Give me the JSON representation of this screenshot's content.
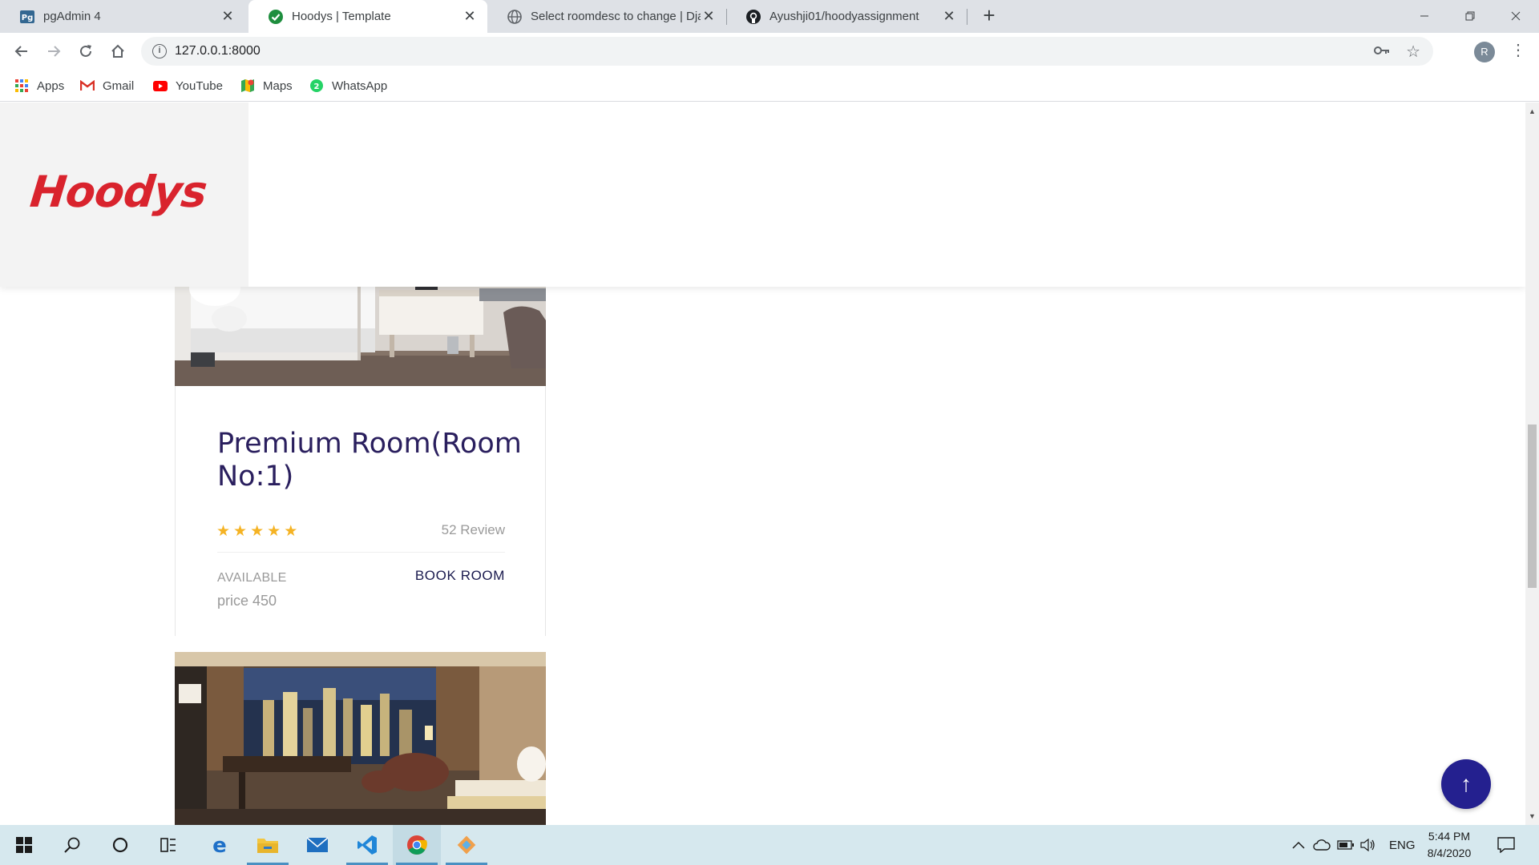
{
  "browser": {
    "tabs": [
      {
        "label": "pgAdmin 4",
        "icon": "pgadmin-icon",
        "active": false
      },
      {
        "label": "Hoodys | Template",
        "icon": "check-circle-icon",
        "active": true
      },
      {
        "label": "Select roomdesc to change | Djan",
        "icon": "globe-icon",
        "active": false
      },
      {
        "label": "Ayushji01/hoodyassignment",
        "icon": "github-icon",
        "active": false
      }
    ],
    "new_tab_glyph": "+",
    "url": "127.0.0.1:8000",
    "profile_initial": "R",
    "bookmarks": [
      {
        "label": "Apps",
        "icon": "apps-grid-icon"
      },
      {
        "label": "Gmail",
        "icon": "gmail-icon"
      },
      {
        "label": "YouTube",
        "icon": "youtube-icon"
      },
      {
        "label": "Maps",
        "icon": "maps-icon"
      },
      {
        "label": "WhatsApp",
        "icon": "whatsapp-icon"
      }
    ]
  },
  "page": {
    "logo": "Hoodys",
    "rooms": [
      {
        "title": "Premium Room(Room No:1)",
        "rating": 5,
        "reviews": "52 Review",
        "status": "AVAILABLE",
        "price": "price 450",
        "book_label": "BOOK ROOM"
      }
    ],
    "scroll_top_glyph": "↑"
  },
  "taskbar": {
    "apps": [
      "start-icon",
      "search-icon",
      "cortana-icon",
      "task-view-icon",
      "edge-icon",
      "file-explorer-icon",
      "mail-icon",
      "vscode-icon",
      "chrome-icon",
      "git-icon"
    ],
    "language": "ENG",
    "time": "5:44 PM",
    "date": "8/4/2020"
  },
  "colors": {
    "brand_red": "#d9232d",
    "title_navy": "#2a1f5e",
    "star_gold": "#f5b324",
    "scroll_button": "#24208f"
  }
}
